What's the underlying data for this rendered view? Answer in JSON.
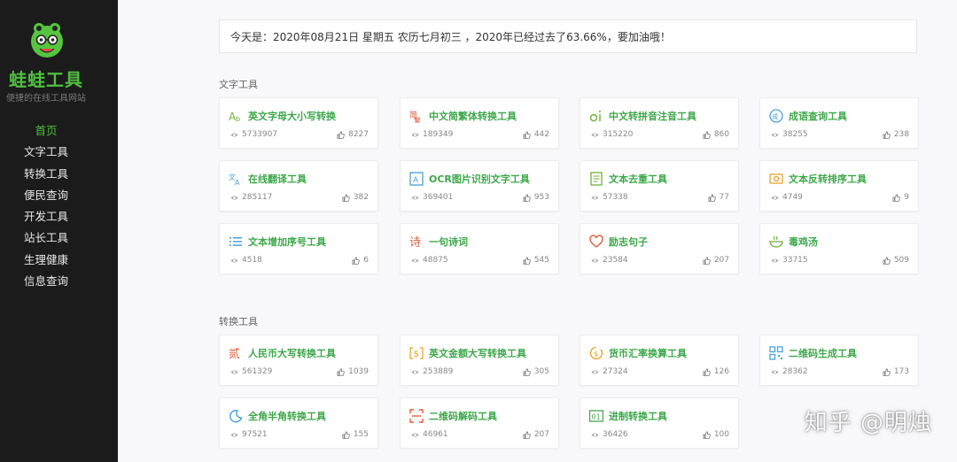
{
  "site": {
    "name": "蛙蛙工具",
    "slogan": "便捷的在线工具网站",
    "brand_color": "#4fbf3f"
  },
  "nav": [
    {
      "label": "首页",
      "active": true
    },
    {
      "label": "文字工具"
    },
    {
      "label": "转换工具"
    },
    {
      "label": "便民查询"
    },
    {
      "label": "开发工具"
    },
    {
      "label": "站长工具"
    },
    {
      "label": "生理健康"
    },
    {
      "label": "信息查询"
    }
  ],
  "notice": "今天是：2020年08月21日 星期五 农历七月初三 ，2020年已经过去了63.66%，要加油哦！",
  "sections": [
    {
      "title": "文字工具",
      "cards": [
        {
          "title": "英文字母大小写转换",
          "icon": "letter-case-icon",
          "views": "5733907",
          "likes": "8227"
        },
        {
          "title": "中文简繁体转换工具",
          "icon": "chinese-convert-icon",
          "views": "189349",
          "likes": "442"
        },
        {
          "title": "中文转拼音注音工具",
          "icon": "pinyin-icon",
          "views": "315220",
          "likes": "860"
        },
        {
          "title": "成语查询工具",
          "icon": "idiom-icon",
          "views": "38255",
          "likes": "238"
        },
        {
          "title": "在线翻译工具",
          "icon": "translate-icon",
          "views": "285117",
          "likes": "382"
        },
        {
          "title": "OCR图片识别文字工具",
          "icon": "ocr-icon",
          "views": "369401",
          "likes": "953"
        },
        {
          "title": "文本去重工具",
          "icon": "document-icon",
          "views": "57338",
          "likes": "77"
        },
        {
          "title": "文本反转排序工具",
          "icon": "reverse-icon",
          "views": "4749",
          "likes": "9"
        },
        {
          "title": "文本增加序号工具",
          "icon": "list-icon",
          "views": "4518",
          "likes": "6"
        },
        {
          "title": "一句诗词",
          "icon": "poem-icon",
          "views": "48875",
          "likes": "545"
        },
        {
          "title": "励志句子",
          "icon": "heart-icon",
          "views": "23584",
          "likes": "207"
        },
        {
          "title": "毒鸡汤",
          "icon": "soup-bowl-icon",
          "views": "33715",
          "likes": "509"
        }
      ]
    },
    {
      "title": "转换工具",
      "cards": [
        {
          "title": "人民币大写转换工具",
          "icon": "rmb-icon",
          "views": "561329",
          "likes": "1039"
        },
        {
          "title": "英文金额大写转换工具",
          "icon": "dollar-icon",
          "views": "253889",
          "likes": "305"
        },
        {
          "title": "货币汇率换算工具",
          "icon": "exchange-rate-icon",
          "views": "27324",
          "likes": "126"
        },
        {
          "title": "二维码生成工具",
          "icon": "qrcode-icon",
          "views": "28362",
          "likes": "173"
        },
        {
          "title": "全角半角转换工具",
          "icon": "moon-icon",
          "views": "97521",
          "likes": "155"
        },
        {
          "title": "二维码解码工具",
          "icon": "scan-icon",
          "views": "46961",
          "likes": "207"
        },
        {
          "title": "进制转换工具",
          "icon": "binary-icon",
          "views": "36426",
          "likes": "100"
        }
      ]
    }
  ],
  "watermark": "知乎 @明烛"
}
